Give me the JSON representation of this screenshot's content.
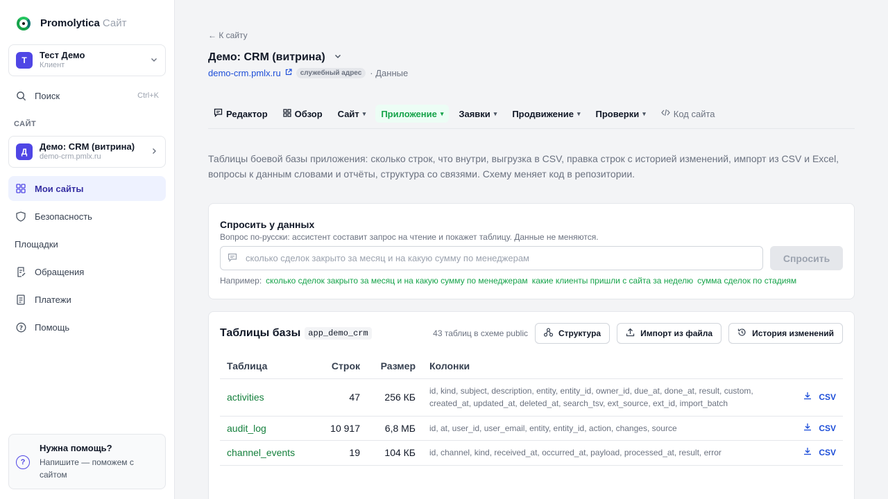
{
  "brand": {
    "name": "Promolytica",
    "sub": "Сайт"
  },
  "account": {
    "initial": "Т",
    "name": "Тест Демо",
    "role": "Клиент"
  },
  "sidebar": {
    "search_label": "Поиск",
    "search_shortcut": "Ctrl+K",
    "section_label": "САЙТ",
    "site": {
      "initial": "Д",
      "name": "Демо: CRM (витрина)",
      "domain": "demo-crm.pmlx.ru"
    },
    "items": [
      {
        "label": "Мои сайты",
        "icon": "grid-icon"
      },
      {
        "label": "Безопасность",
        "icon": "shield-icon"
      },
      {
        "label": "Площадки",
        "icon": ""
      },
      {
        "label": "Обращения",
        "icon": "file-edit-icon"
      },
      {
        "label": "Платежи",
        "icon": "receipt-icon"
      },
      {
        "label": "Помощь",
        "icon": "help-circle-icon"
      }
    ],
    "help": {
      "title": "Нужна помощь?",
      "text": "Напишите — поможем с сайтом"
    }
  },
  "header": {
    "back": "← К сайту",
    "title": "Демо: CRM (витрина)",
    "domain": "demo-crm.pmlx.ru",
    "badge": "служебный адрес",
    "crumb": "· Данные"
  },
  "tabs": [
    {
      "label": "Редактор",
      "icon": "💬"
    },
    {
      "label": "Обзор",
      "icon": "▦"
    },
    {
      "label": "Сайт",
      "dropdown": true
    },
    {
      "label": "Приложение",
      "dropdown": true,
      "active": true
    },
    {
      "label": "Заявки",
      "dropdown": true
    },
    {
      "label": "Продвижение",
      "dropdown": true
    },
    {
      "label": "Проверки",
      "dropdown": true
    },
    {
      "label": "Код сайта",
      "icon": "</>"
    }
  ],
  "description": "Таблицы боевой базы приложения: сколько строк, что внутри, выгрузка в CSV, правка строк с историей изменений, импорт из CSV и Excel, вопросы к данным словами и отчёты, структура со связями. Схему меняет код в репозитории.",
  "ask": {
    "title": "Спросить у данных",
    "subtitle": "Вопрос по-русски: ассистент составит запрос на чтение и покажет таблицу. Данные не меняются.",
    "placeholder": "сколько сделок закрыто за месяц и на какую сумму по менеджерам",
    "button": "Спросить",
    "examples_label": "Например:",
    "examples": [
      "сколько сделок закрыто за месяц и на какую сумму по менеджерам",
      "какие клиенты пришли с сайта за неделю",
      "сумма сделок по стадиям"
    ]
  },
  "tables": {
    "title": "Таблицы базы",
    "schema": "app_demo_crm",
    "count": "43 таблиц в схеме public",
    "buttons": {
      "structure": "Структура",
      "import": "Импорт из файла",
      "history": "История изменений"
    },
    "columns": [
      "Таблица",
      "Строк",
      "Размер",
      "Колонки"
    ],
    "csv_label": "CSV",
    "rows": [
      {
        "name": "activities",
        "rows": "47",
        "size": "256 КБ",
        "cols": "id, kind, subject, description, entity, entity_id, owner_id, due_at, done_at, result, custom, created_at, updated_at, deleted_at, search_tsv, ext_source, ext_id, import_batch"
      },
      {
        "name": "audit_log",
        "rows": "10 917",
        "size": "6,8 МБ",
        "cols": "id, at, user_id, user_email, entity, entity_id, action, changes, source"
      },
      {
        "name": "channel_events",
        "rows": "19",
        "size": "104 КБ",
        "cols": "id, channel, kind, received_at, occurred_at, payload, processed_at, result, error"
      }
    ]
  }
}
